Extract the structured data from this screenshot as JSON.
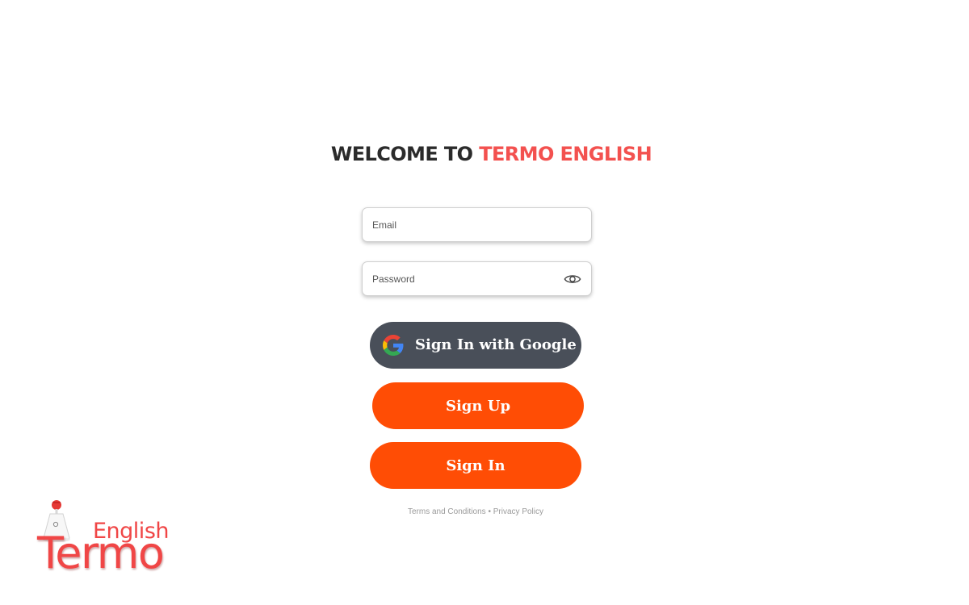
{
  "heading": {
    "prefix": "WELCOME TO",
    "brand": "TERMO ENGLISH"
  },
  "form": {
    "email_placeholder": "Email",
    "password_placeholder": "Password",
    "show_password_icon": "eye-icon"
  },
  "buttons": {
    "google": "Sign In with Google",
    "google_icon": "google-icon",
    "signup": "Sign Up",
    "signin": "Sign In"
  },
  "footer": {
    "terms": "Terms and Conditions",
    "separator": "•",
    "privacy": "Privacy Policy"
  },
  "logo": {
    "small_word": "English",
    "big_word": "Termo",
    "lamp_icon": "lamp-icon"
  },
  "colors": {
    "accent": "#f3514f",
    "primary_button": "#ff4d05",
    "google_button": "#494f59",
    "title_text": "#2b2b2b"
  }
}
